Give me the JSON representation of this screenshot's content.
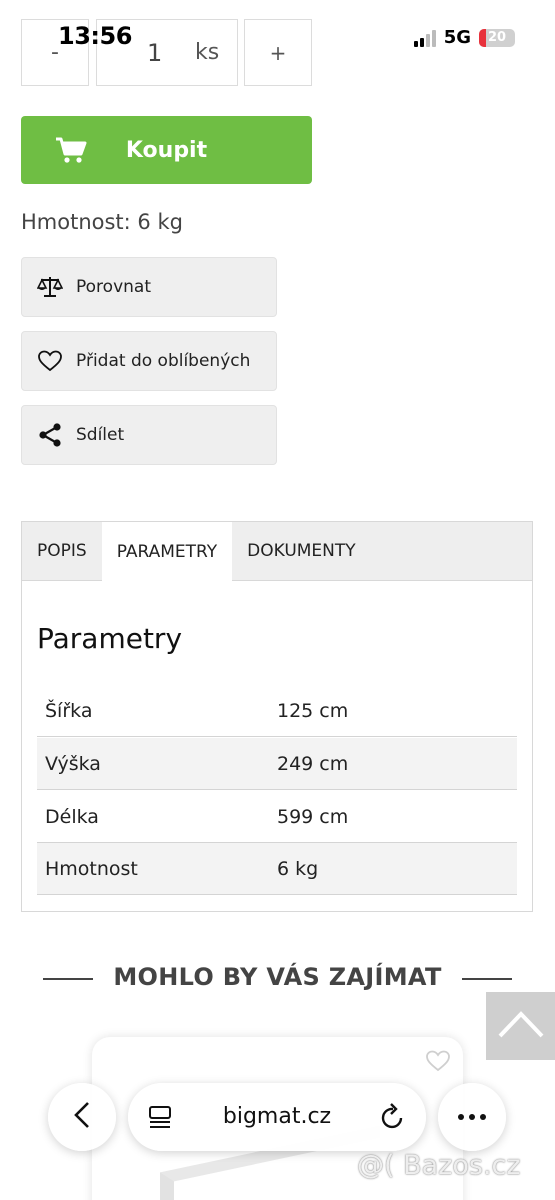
{
  "status_bar": {
    "time": "13:56",
    "network": "5G",
    "battery": "20",
    "battery_level_percent": 20,
    "battery_color": "#e8323c"
  },
  "quantity": {
    "minus_label": "-",
    "value": "1",
    "unit": "ks",
    "plus_label": "+"
  },
  "buy": {
    "label": "Koupit",
    "color": "#6fbe44",
    "icon": "cart-icon"
  },
  "weight_text": "Hmotnost: 6 kg",
  "actions": [
    {
      "label": "Porovnat",
      "icon": "scale-icon"
    },
    {
      "label": "Přidat do oblíbených",
      "icon": "heart-icon"
    },
    {
      "label": "Sdílet",
      "icon": "share-icon"
    }
  ],
  "tabs": [
    {
      "label": "POPIS",
      "active": false
    },
    {
      "label": "PARAMETRY",
      "active": true
    },
    {
      "label": "DOKUMENTY",
      "active": false
    }
  ],
  "parameters": {
    "title": "Parametry",
    "rows": [
      {
        "key": "Šířka",
        "value": "125 cm"
      },
      {
        "key": "Výška",
        "value": "249 cm"
      },
      {
        "key": "Délka",
        "value": "599 cm"
      },
      {
        "key": "Hmotnost",
        "value": "6 kg"
      }
    ]
  },
  "recommended_title": "MOHLO BY VÁS ZAJÍMAT",
  "browser": {
    "domain": "bigmat.cz"
  },
  "watermark": "@( Bazos.cz"
}
